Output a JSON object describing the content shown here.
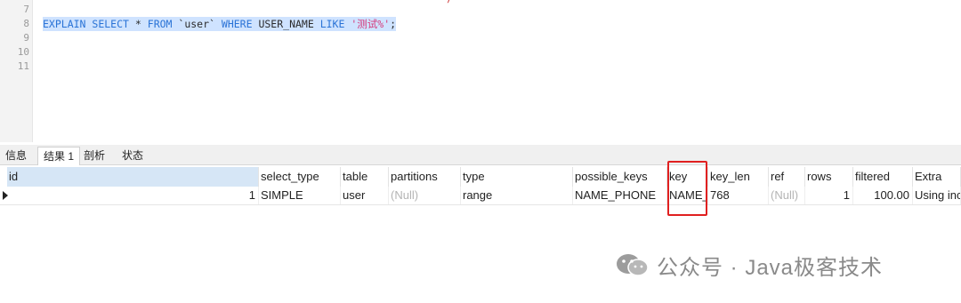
{
  "editor": {
    "lines": [
      {
        "no": "7"
      },
      {
        "no": "8"
      },
      {
        "no": "9"
      },
      {
        "no": "10"
      },
      {
        "no": "11"
      }
    ],
    "query": {
      "explain": "EXPLAIN",
      "select": "SELECT",
      "star": "*",
      "from": "FROM",
      "table": "`user`",
      "where": "WHERE",
      "column": "USER_NAME",
      "like": "LIKE",
      "value": "'测试%'",
      "end": ";"
    }
  },
  "tabs": [
    {
      "label": "信息"
    },
    {
      "label": "结果 1"
    },
    {
      "label": "剖析"
    },
    {
      "label": "状态"
    }
  ],
  "grid": {
    "headers": [
      "id",
      "select_type",
      "table",
      "partitions",
      "type",
      "possible_keys",
      "key",
      "key_len",
      "ref",
      "rows",
      "filtered",
      "Extra"
    ],
    "row": [
      "1",
      "SIMPLE",
      "user",
      "(Null)",
      "range",
      "NAME_PHONE",
      "NAME_",
      "768",
      "(Null)",
      "1",
      "100.00",
      "Using inc"
    ]
  },
  "watermark": {
    "text": "公众号 · Java极客技术"
  },
  "colors": {
    "selection": "#cfe3ff",
    "keyword": "#2a73d6",
    "string": "#d63a7a",
    "highlight_box": "#e02020"
  }
}
